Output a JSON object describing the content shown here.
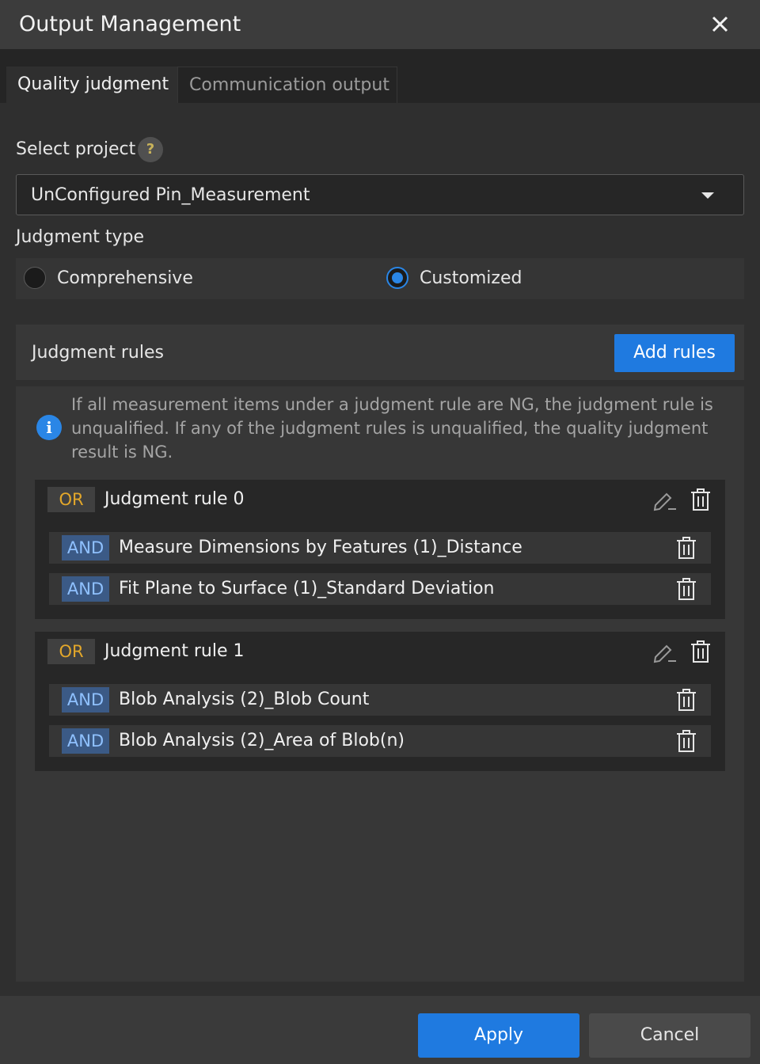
{
  "window": {
    "title": "Output Management",
    "close_icon": "close-icon"
  },
  "tabs": [
    {
      "label": "Quality judgment",
      "active": true
    },
    {
      "label": "Communication output",
      "active": false
    }
  ],
  "select_project": {
    "label": "Select project",
    "help_glyph": "?",
    "value": "UnConfigured Pin_Measurement"
  },
  "judgment_type": {
    "label": "Judgment type",
    "options": [
      {
        "label": "Comprehensive",
        "selected": false
      },
      {
        "label": "Customized",
        "selected": true
      }
    ]
  },
  "rules": {
    "header": "Judgment rules",
    "add_button": "Add rules",
    "info_glyph": "i",
    "info_text": "If all measurement items under a judgment rule are NG, the judgment rule is unqualified. If any of the judgment rules is unqualified, the quality judgment result is NG.",
    "list": [
      {
        "operator": "OR",
        "name": "Judgment rule 0",
        "items": [
          {
            "operator": "AND",
            "name": "Measure Dimensions by Features (1)_Distance"
          },
          {
            "operator": "AND",
            "name": "Fit Plane to Surface (1)_Standard Deviation"
          }
        ]
      },
      {
        "operator": "OR",
        "name": "Judgment rule 1",
        "items": [
          {
            "operator": "AND",
            "name": "Blob Analysis (2)_Blob Count"
          },
          {
            "operator": "AND",
            "name": "Blob Analysis (2)_Area of Blob(n)"
          }
        ]
      }
    ]
  },
  "footer": {
    "apply": "Apply",
    "cancel": "Cancel"
  },
  "colors": {
    "accent": "#1f7ae0",
    "or_text": "#e3a72a",
    "and_text": "#8fc1ff"
  }
}
